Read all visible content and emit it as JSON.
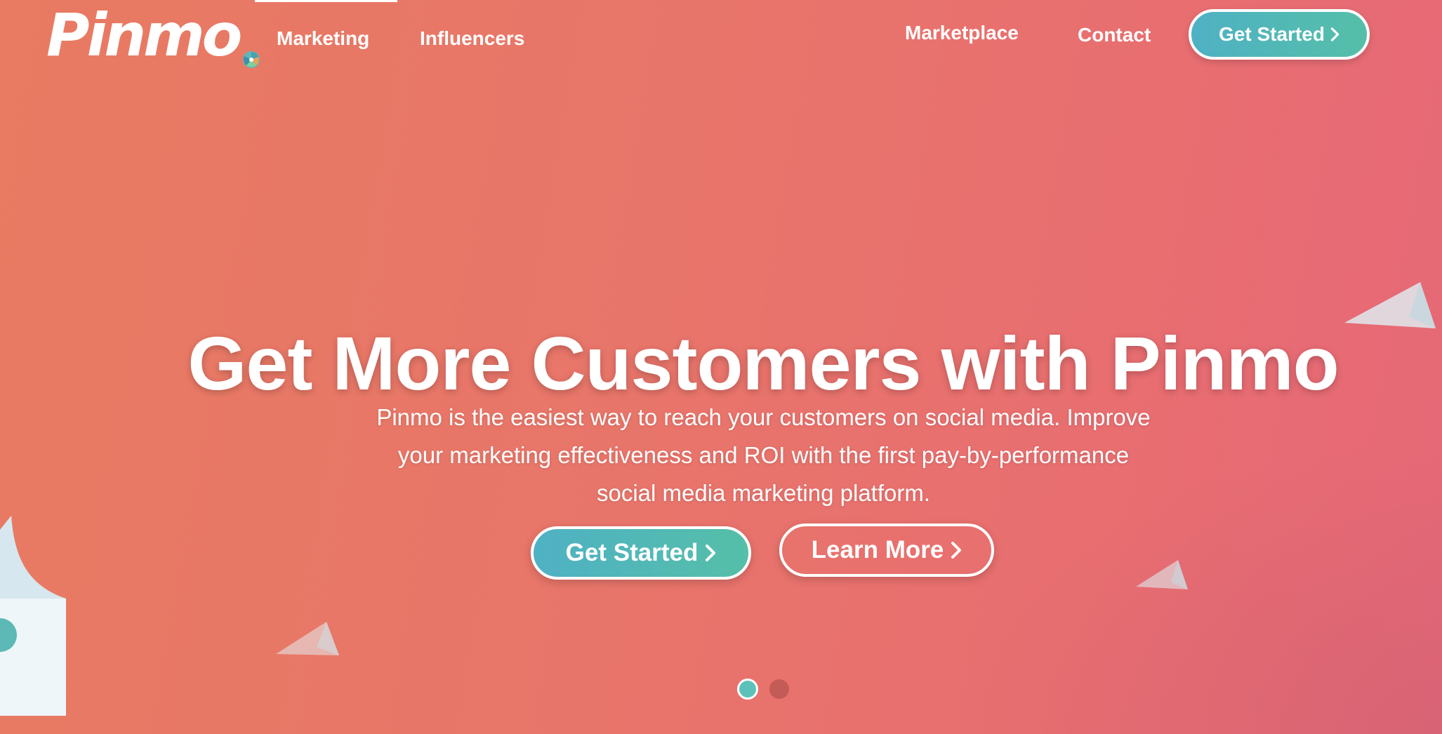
{
  "nav": {
    "logo_text": "Pinmo",
    "links": [
      {
        "label": "Marketing"
      },
      {
        "label": "Influencers"
      },
      {
        "label": "Marketplace"
      },
      {
        "label": "Contact"
      }
    ],
    "cta_label": "Get Started"
  },
  "hero": {
    "title": "Get More Customers with Pinmo",
    "subtitle": "Pinmo is the easiest way to reach your customers on social media. Improve your marketing effectiveness and ROI with the first pay-by-performance social media marketing platform.",
    "primary_button": "Get Started",
    "secondary_button": "Learn More"
  },
  "carousel": {
    "slide_count": 2,
    "active_index": 0
  },
  "colors": {
    "background_start": "#e87b62",
    "background_end": "#e66878",
    "accent_teal": "#4fb1c4",
    "accent_green": "#55bfa8",
    "text": "#ffffff"
  },
  "icons": [
    "logo-spiral-icon",
    "chevron-right-icon",
    "paper-plane-icon"
  ]
}
